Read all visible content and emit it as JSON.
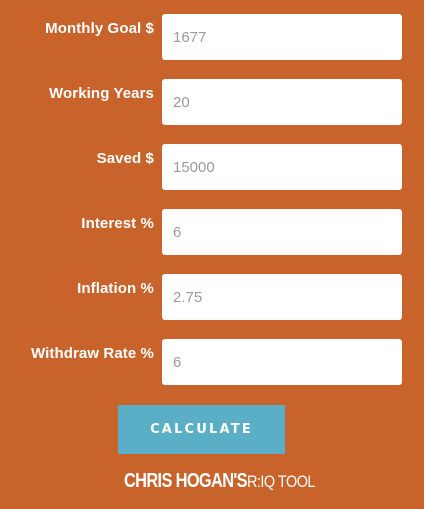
{
  "form": {
    "fields": [
      {
        "label": "Monthly Goal $",
        "value": "1677"
      },
      {
        "label": "Working Years",
        "value": "20"
      },
      {
        "label": "Saved $",
        "value": "15000"
      },
      {
        "label": "Interest %",
        "value": "6"
      },
      {
        "label": "Inflation %",
        "value": "2.75"
      },
      {
        "label": "Withdraw Rate %",
        "value": "6"
      }
    ],
    "calculate_label": "CALCULATE"
  },
  "brand": {
    "name": "CHRIS HOGAN'S",
    "tool": "R:IQ TOOL"
  },
  "colors": {
    "background": "#c8632b",
    "button": "#5aafc6",
    "field_text": "#9a9a9a"
  }
}
